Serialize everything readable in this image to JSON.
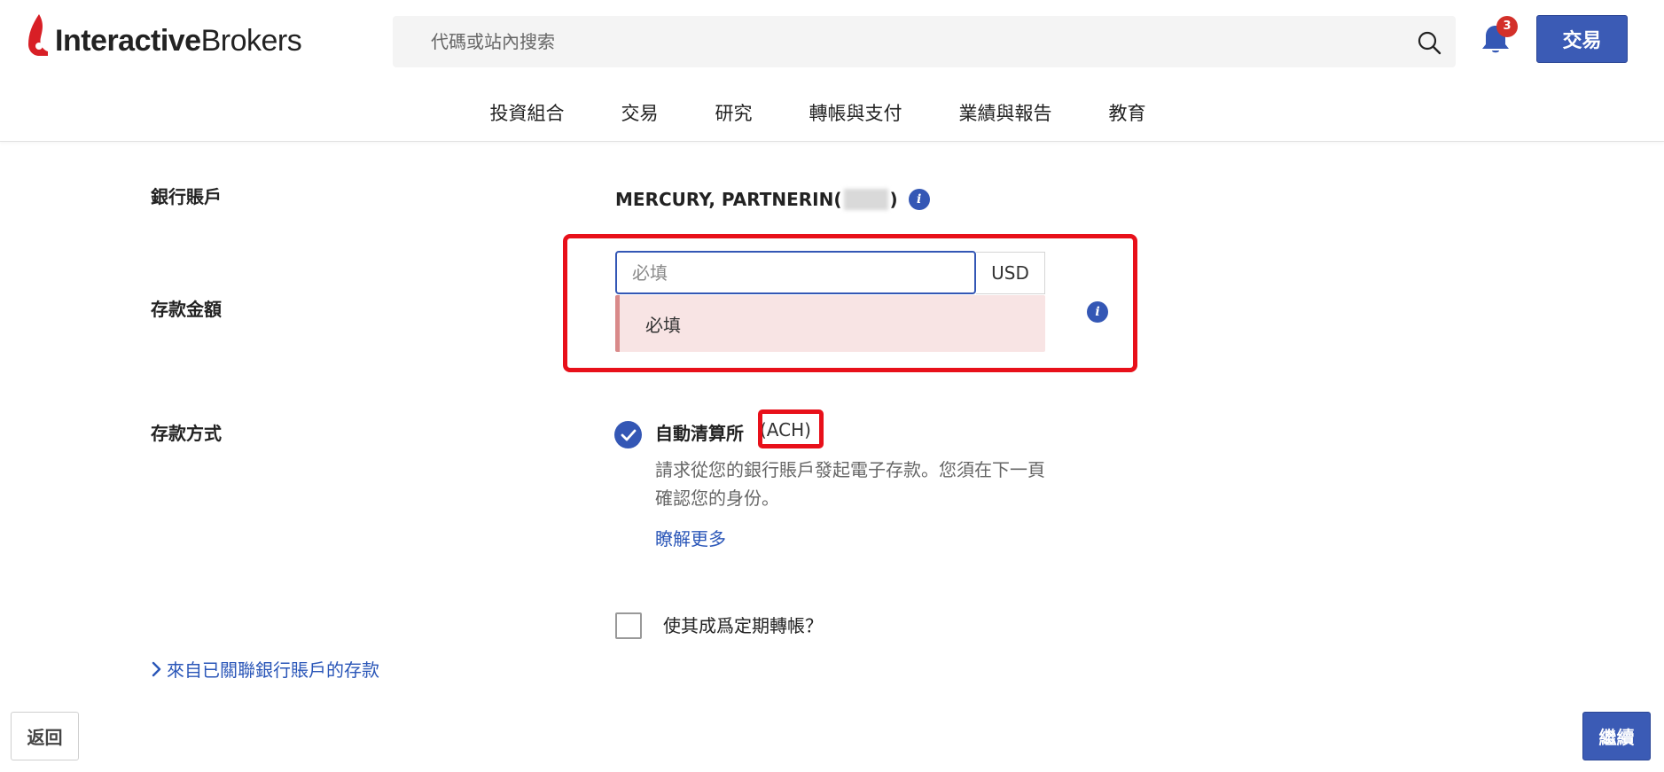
{
  "header": {
    "logo_bold": "Interactive",
    "logo_regular": "Brokers",
    "search_placeholder": "代碼或站內搜索",
    "notification_count": "3",
    "trade_button": "交易",
    "nav": [
      "投資組合",
      "交易",
      "研究",
      "轉帳與支付",
      "業績與報告",
      "教育"
    ]
  },
  "form": {
    "bank_account": {
      "label": "銀行賬戶",
      "value_prefix": "MERCURY, PARTNERIN(",
      "value_suffix": ")"
    },
    "deposit_amount": {
      "label": "存款金額",
      "placeholder": "必填",
      "currency": "USD",
      "error": "必填"
    },
    "deposit_method": {
      "label": "存款方式",
      "option_name": "自動清算所",
      "option_code": "(ACH)",
      "description": "請求從您的銀行賬戶發起電子存款。您須在下一頁確認您的身份。",
      "learn_more": "瞭解更多",
      "selected": true
    },
    "recurring": {
      "label": "使其成爲定期轉帳？",
      "checked": false
    },
    "linked_accounts_link": "來自已關聯銀行賬戶的存款"
  },
  "footer": {
    "back": "返回",
    "continue": "繼續"
  },
  "colors": {
    "brand_blue": "#3b5bb5",
    "link_blue": "#2a56b8",
    "highlight_red": "#e8101a",
    "error_bg": "#f8e4e4",
    "logo_red": "#d81f26"
  },
  "icons": [
    "flame-logo-icon",
    "search-icon",
    "bell-icon",
    "info-icon",
    "check-icon",
    "chevron-right-icon"
  ]
}
